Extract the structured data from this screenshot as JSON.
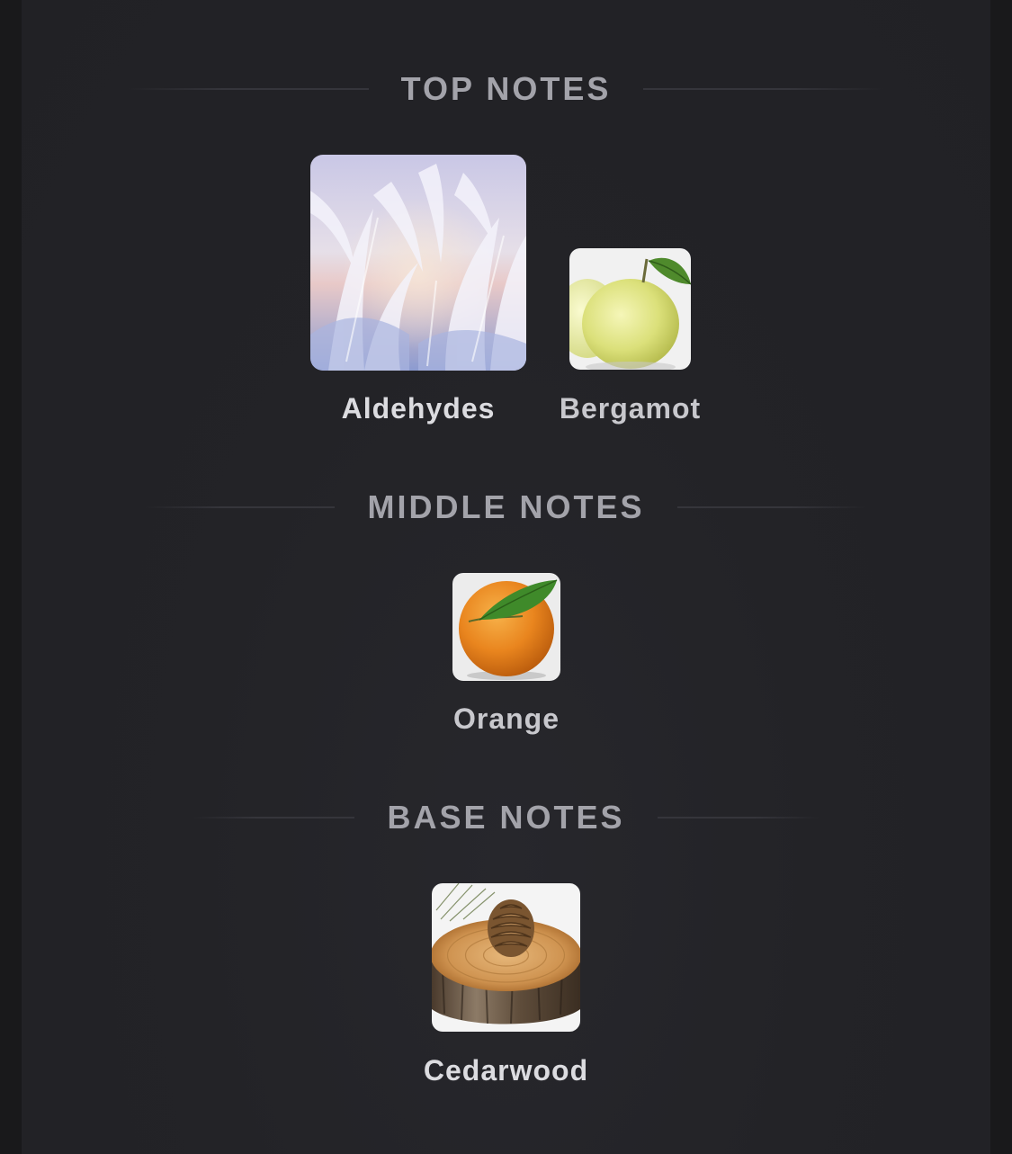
{
  "sections": [
    {
      "title": "TOP NOTES",
      "notes": [
        {
          "name": "Aldehydes",
          "image": "frost-crystals-image"
        },
        {
          "name": "Bergamot",
          "image": "bergamot-fruit-image"
        }
      ]
    },
    {
      "title": "MIDDLE NOTES",
      "notes": [
        {
          "name": "Orange",
          "image": "orange-fruit-image"
        }
      ]
    },
    {
      "title": "BASE NOTES",
      "notes": [
        {
          "name": "Cedarwood",
          "image": "cedar-log-pinecone-image"
        }
      ]
    }
  ],
  "colors": {
    "background": "#232327",
    "section_title": "#a3a3aa",
    "note_label": "#dcdce0"
  }
}
